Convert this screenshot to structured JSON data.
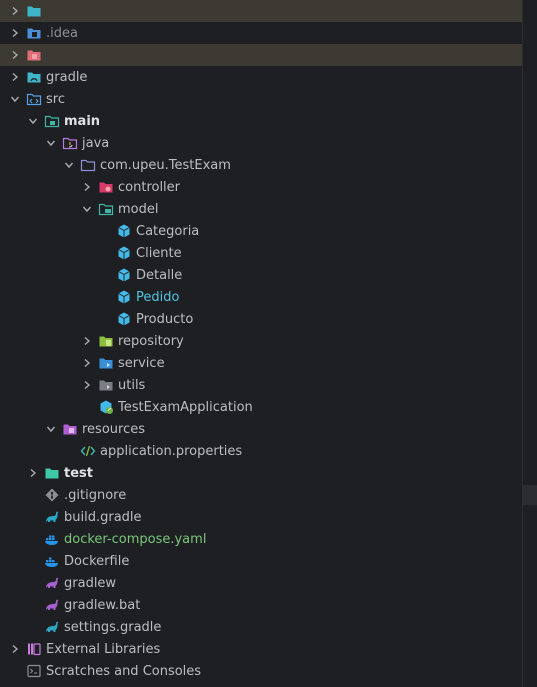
{
  "colors": {
    "text": "#bcbec4",
    "text_bold": "#dfe1e5",
    "text_muted": "#8c8f94",
    "text_green": "#7ac77a",
    "text_cyan": "#56c3e0",
    "highlight": "#3c3a32"
  },
  "tree": [
    {
      "label": "",
      "icon": "folder-cyan-icon",
      "expanded": false,
      "highlight": "dim",
      "style": "muted"
    },
    {
      "label": ".idea",
      "icon": "folder-idea-icon",
      "expanded": false,
      "style": "muted"
    },
    {
      "label": "",
      "icon": "folder-red-icon",
      "expanded": false,
      "highlight": "dim",
      "style": "muted"
    },
    {
      "label": "gradle",
      "icon": "folder-gradle-icon",
      "expanded": false
    },
    {
      "label": "src",
      "icon": "folder-src-icon",
      "expanded": true
    },
    {
      "label": "main",
      "icon": "folder-main-icon",
      "expanded": true,
      "style": "bold"
    },
    {
      "label": "java",
      "icon": "folder-java-icon",
      "expanded": true
    },
    {
      "label": "com.upeu.TestExam",
      "icon": "package-icon",
      "expanded": true
    },
    {
      "label": "controller",
      "icon": "package-controller-icon",
      "expanded": false
    },
    {
      "label": "model",
      "icon": "package-model-icon",
      "expanded": true
    },
    {
      "label": "Categoria",
      "icon": "entity-icon"
    },
    {
      "label": "Cliente",
      "icon": "entity-icon"
    },
    {
      "label": "Detalle",
      "icon": "entity-icon"
    },
    {
      "label": "Pedido",
      "icon": "entity-icon",
      "style": "cyan"
    },
    {
      "label": "Producto",
      "icon": "entity-icon"
    },
    {
      "label": "repository",
      "icon": "package-repository-icon",
      "expanded": false
    },
    {
      "label": "service",
      "icon": "package-service-icon",
      "expanded": false
    },
    {
      "label": "utils",
      "icon": "package-utils-icon",
      "expanded": false
    },
    {
      "label": "TestExamApplication",
      "icon": "spring-app-icon"
    },
    {
      "label": "resources",
      "icon": "folder-resources-icon",
      "expanded": true
    },
    {
      "label": "application.properties",
      "icon": "properties-icon"
    },
    {
      "label": "test",
      "icon": "folder-test-icon",
      "expanded": false,
      "style": "bold"
    },
    {
      "label": ".gitignore",
      "icon": "git-icon"
    },
    {
      "label": "build.gradle",
      "icon": "gradle-file-icon"
    },
    {
      "label": "docker-compose.yaml",
      "icon": "docker-compose-icon",
      "style": "green"
    },
    {
      "label": "Dockerfile",
      "icon": "docker-icon"
    },
    {
      "label": "gradlew",
      "icon": "gradlew-icon"
    },
    {
      "label": "gradlew.bat",
      "icon": "gradlew-icon"
    },
    {
      "label": "settings.gradle",
      "icon": "gradle-file-icon"
    },
    {
      "label": "External Libraries",
      "icon": "external-libraries-icon",
      "expanded": false
    },
    {
      "label": "Scratches and Consoles",
      "icon": "scratches-icon"
    }
  ]
}
